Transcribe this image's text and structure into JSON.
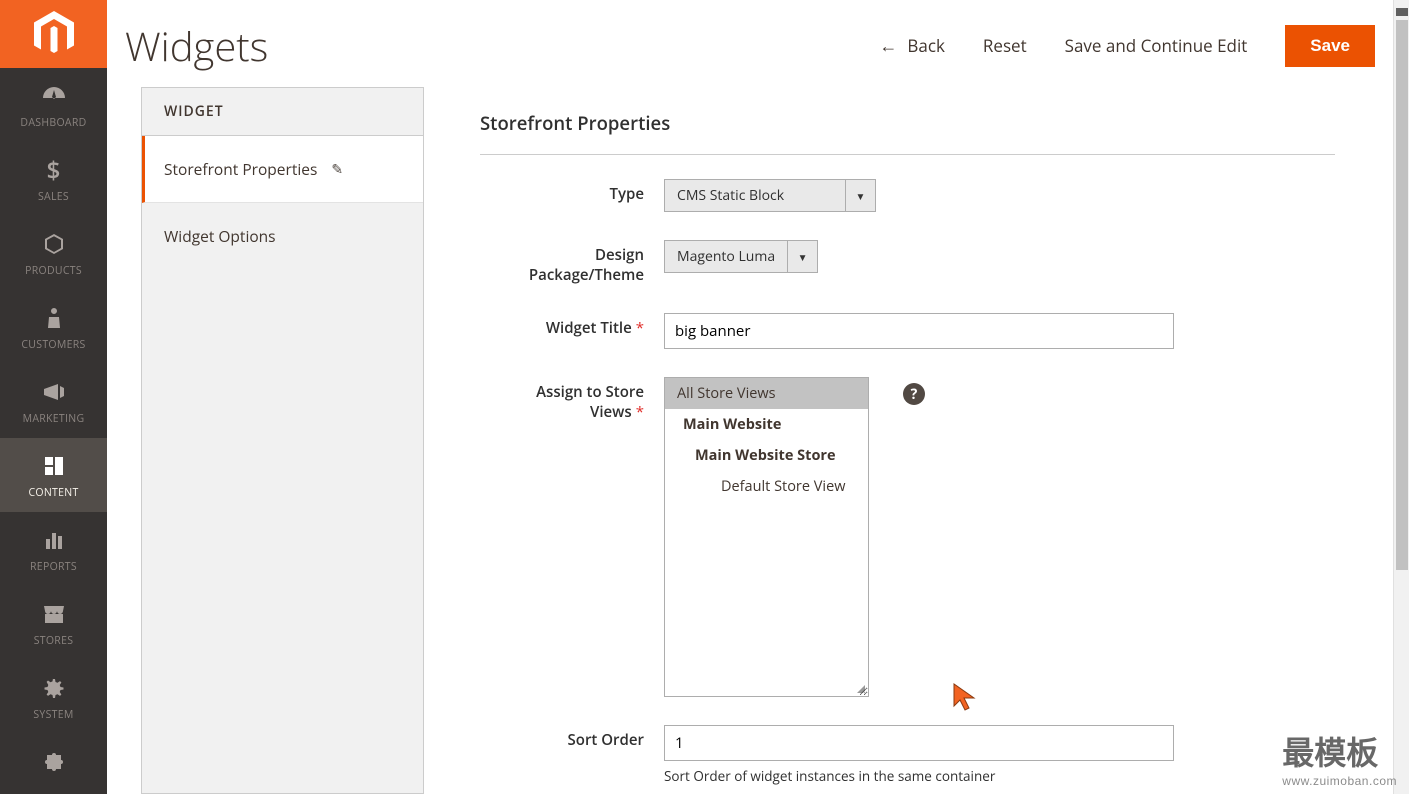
{
  "header": {
    "page_title": "Widgets",
    "back": "Back",
    "reset": "Reset",
    "save_continue": "Save and Continue Edit",
    "save": "Save"
  },
  "sidebar": {
    "items": [
      {
        "label": "DASHBOARD",
        "icon": "dashboard"
      },
      {
        "label": "SALES",
        "icon": "dollar"
      },
      {
        "label": "PRODUCTS",
        "icon": "cube"
      },
      {
        "label": "CUSTOMERS",
        "icon": "person"
      },
      {
        "label": "MARKETING",
        "icon": "megaphone"
      },
      {
        "label": "CONTENT",
        "icon": "content"
      },
      {
        "label": "REPORTS",
        "icon": "bar"
      },
      {
        "label": "STORES",
        "icon": "store"
      },
      {
        "label": "SYSTEM",
        "icon": "gear"
      },
      {
        "label": "",
        "icon": "puzzle"
      }
    ],
    "active_index": 5
  },
  "tabs": {
    "header": "WIDGET",
    "items": [
      {
        "label": "Storefront Properties",
        "active": true,
        "editable": true
      },
      {
        "label": "Widget Options",
        "active": false,
        "editable": false
      }
    ]
  },
  "form": {
    "section_title": "Storefront Properties",
    "type_label": "Type",
    "type_value": "CMS Static Block",
    "theme_label": "Design Package/Theme",
    "theme_value": "Magento Luma",
    "title_label": "Widget Title",
    "title_value": "big banner",
    "stores_label": "Assign to Store Views",
    "stores_options": [
      {
        "text": "All Store Views",
        "level": 0,
        "selected": true
      },
      {
        "text": "Main Website",
        "level": 1,
        "selected": false
      },
      {
        "text": "Main Website Store",
        "level": 2,
        "selected": false
      },
      {
        "text": "Default Store View",
        "level": 3,
        "selected": false
      }
    ],
    "sort_label": "Sort Order",
    "sort_value": "1",
    "sort_note": "Sort Order of widget instances in the same container"
  },
  "watermark": {
    "main": "最模板",
    "sub": "www.zuimoban.com"
  }
}
